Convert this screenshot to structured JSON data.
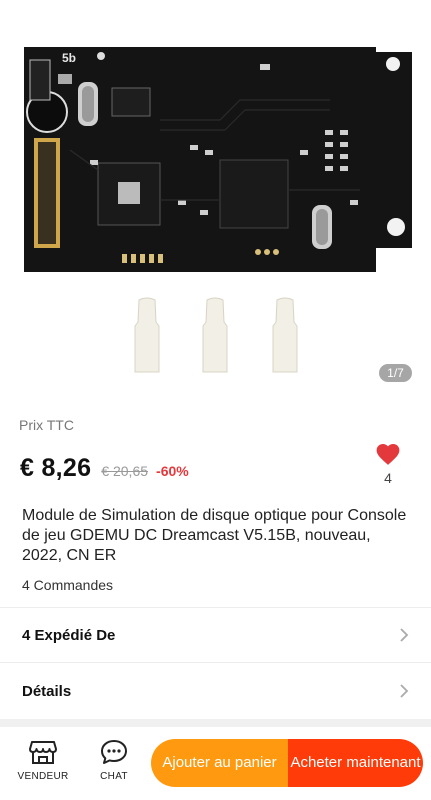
{
  "gallery": {
    "counter": "1/7",
    "board_silkscreen": "5b"
  },
  "price": {
    "label": "Prix TTC",
    "current": "€ 8,26",
    "original": "€ 20,65",
    "discount": "-60%"
  },
  "wishlist": {
    "count": "4",
    "icon": "heart-icon",
    "color": "#e4393c"
  },
  "product": {
    "title": "Module de Simulation de disque optique pour Console de jeu GDEMU DC Dreamcast V5.15B, nouveau, 2022, CN ER",
    "orders": "4 Commandes"
  },
  "sections": {
    "shipping_label": "4 Expédié De",
    "details_label": "Détails"
  },
  "bottom_bar": {
    "store_label": "VENDEUR",
    "chat_label": "CHAT",
    "add_to_cart": "Ajouter au panier",
    "buy_now": "Acheter maintenant",
    "colors": {
      "cart": "#ff9a10",
      "buy": "#ff3b0a"
    }
  }
}
